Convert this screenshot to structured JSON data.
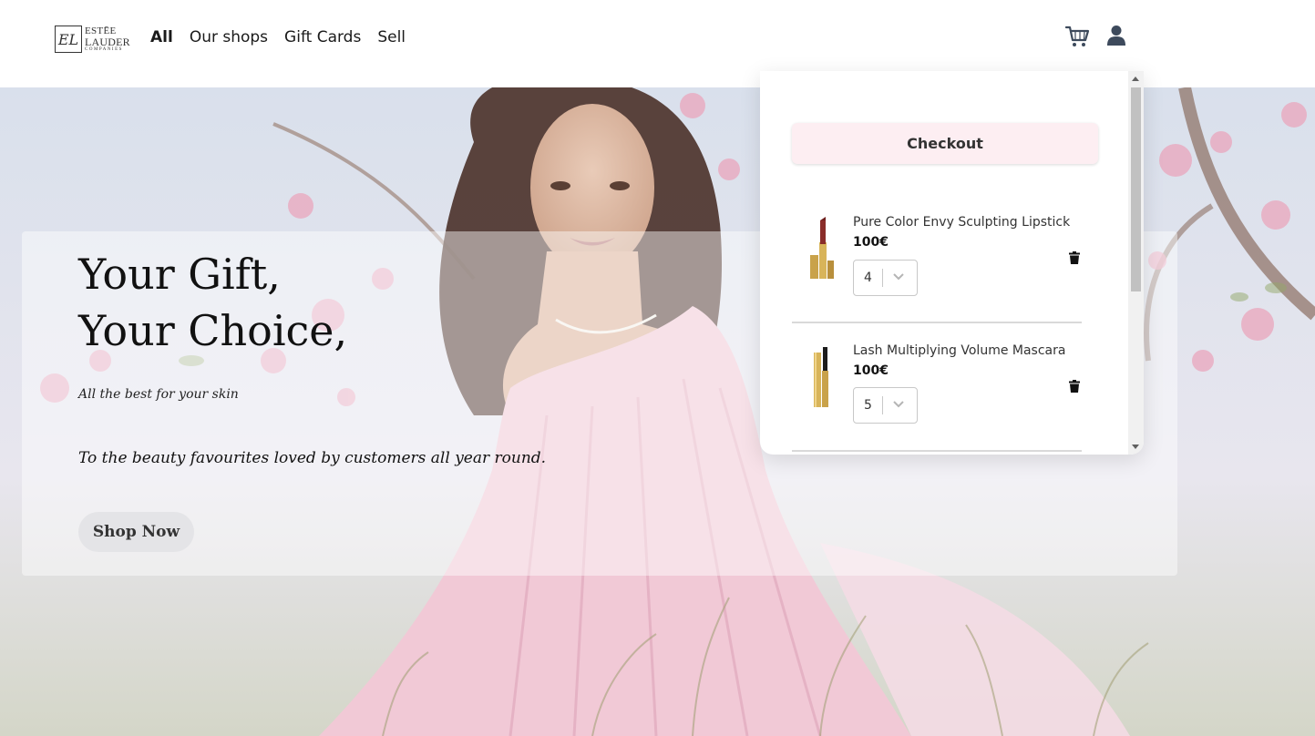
{
  "brand": {
    "logo_line1": "ESTĒE",
    "logo_line2": "LAUDER",
    "logo_line3": "COMPANIES"
  },
  "nav": {
    "items": [
      {
        "label": "All",
        "active": true
      },
      {
        "label": "Our shops",
        "active": false
      },
      {
        "label": "Gift Cards",
        "active": false
      },
      {
        "label": "Sell",
        "active": false
      }
    ]
  },
  "header_icons": [
    "cart-icon",
    "user-icon"
  ],
  "hero": {
    "title_line1": "Your Gift,",
    "title_line2": "Your Choice,",
    "subtitle": "All the best for your skin",
    "text": "To the beauty favourites loved by customers all year round.",
    "button_label": "Shop Now"
  },
  "cart": {
    "checkout_label": "Checkout",
    "items": [
      {
        "name": "Pure Color Envy Sculpting Lipstick",
        "price": "100€",
        "quantity": "4",
        "icon": "lipstick"
      },
      {
        "name": "Lash Multiplying Volume Mascara",
        "price": "100€",
        "quantity": "5",
        "icon": "mascara"
      }
    ]
  },
  "colors": {
    "checkout_bg": "#fdeef2",
    "hero_panel": "rgba(255,255,255,0.45)",
    "dress_pink": "#f1c9d6"
  }
}
